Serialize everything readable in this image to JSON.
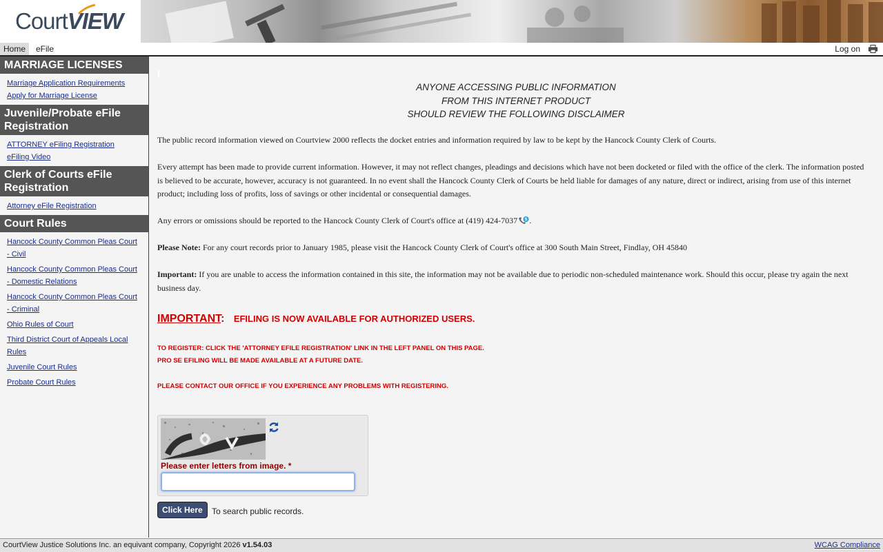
{
  "header": {
    "logo_light": "Court",
    "logo_bold": "VIEW"
  },
  "nav": {
    "home": "Home",
    "efile": "eFile",
    "logon": "Log on"
  },
  "sidebar": {
    "sections": [
      {
        "title": "MARRIAGE LICENSES",
        "links": [
          "Marriage Application Requirements",
          "Apply for Marriage License"
        ]
      },
      {
        "title": "Juvenile/Probate eFile Registration",
        "links": [
          "ATTORNEY eFiling Registration",
          "eFiling Video"
        ]
      },
      {
        "title": "Clerk of Courts eFile Registration",
        "links": [
          "Attorney eFile Registration"
        ]
      },
      {
        "title": "Court Rules",
        "links": [
          "Hancock County Common Pleas Court - Civil",
          "Hancock County Common Pleas Court - Domestic Relations",
          "Hancock County Common Pleas Court - Criminal",
          "Ohio Rules of Court",
          "Third District Court of Appeals Local Rules",
          "Juvenile Court Rules",
          "Probate Court Rules"
        ]
      }
    ]
  },
  "main": {
    "disclaimer_lines": [
      "ANYONE ACCESSING PUBLIC INFORMATION",
      "FROM THIS INTERNET PRODUCT",
      "SHOULD REVIEW THE FOLLOWING DISCLAIMER"
    ],
    "para1": "The public record information viewed on Courtview 2000 reflects the docket entries and information required by law to be kept by the Hancock County Clerk of Courts.",
    "para2": "Every attempt has been made to provide current information. However, it may not reflect changes, pleadings and decisions which have not been docketed or filed with the office of the clerk. The information posted is believed to be accurate, however, accuracy is not guaranteed. In no event shall the Hancock County Clerk of Courts be held liable for damages of any nature, direct or indirect, arising from use of this internet product; including loss of profits, loss of savings or other incidental or consequential damages.",
    "para3": "Any errors or omissions should be reported to the Hancock County Clerk of Court's office at (419) 424-7037",
    "para3_end": ".",
    "note_label": "Please Note:",
    "note_text": " For any court records prior to January 1985, please visit the Hancock County Clerk of Court's office at 300 South Main Street, Findlay, OH 45840",
    "important_label": "Important:",
    "important_text": " If you are unable to access the information contained in this site, the information may not be available due to periodic non-scheduled maintenance work. Should this occur, please try again the next business day.",
    "alert_label": "IMPORTANT",
    "alert_colon": ":",
    "alert_message": "EFILING IS NOW AVAILABLE FOR AUTHORIZED USERS.",
    "register_line1": "TO REGISTER: CLICK THE 'ATTORNEY EFILE REGISTRATION' LINK IN THE LEFT PANEL ON THIS PAGE.",
    "register_line2": "PRO SE EFILING WILL BE MADE AVAILABLE AT A FUTURE DATE.",
    "contact_line": "PLEASE CONTACT OUR OFFICE IF YOU EXPERIENCE ANY PROBLEMS WITH REGISTERING."
  },
  "captcha": {
    "label": "Please enter letters from image. *",
    "value": "",
    "placeholder": ""
  },
  "search": {
    "button_label": "Click Here",
    "note": "To search public records."
  },
  "footer": {
    "copyright": "CourtView Justice Solutions Inc. an equivant company, Copyright 2026 ",
    "version": "v1.54.03",
    "wcag": "WCAG Compliance"
  },
  "colors": {
    "sidebar_header": "#555555",
    "link": "#1a2d8a",
    "alert_red": "#d00000",
    "button": "#3c4c72"
  }
}
